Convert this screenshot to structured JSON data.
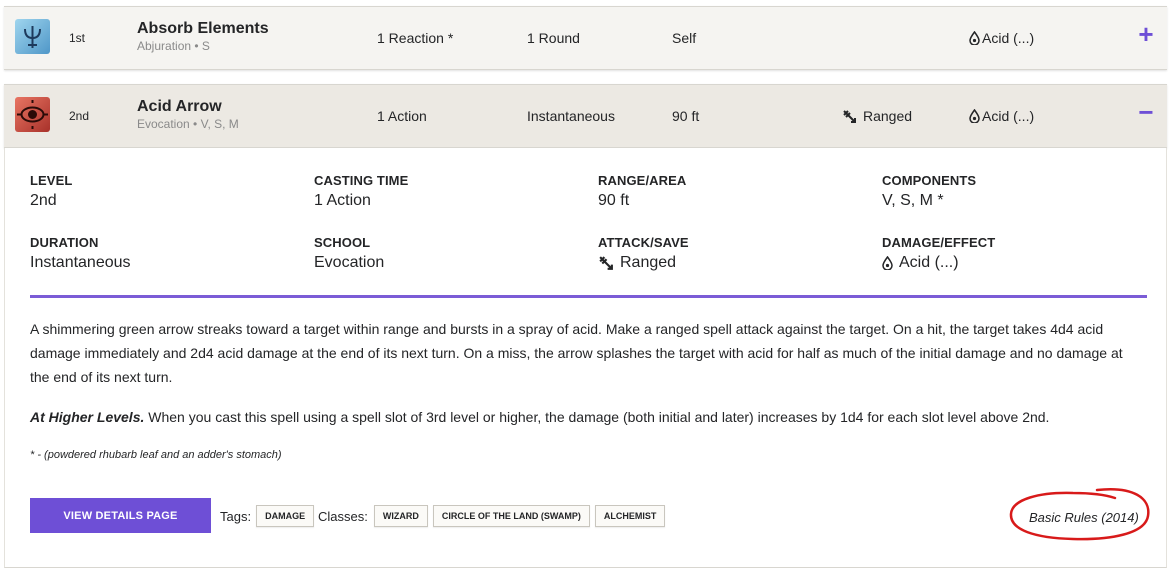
{
  "spells": [
    {
      "level": "1st",
      "name": "Absorb Elements",
      "school": "Abjuration • S",
      "casting_time": "1 Reaction *",
      "duration": "1 Round",
      "range": "Self",
      "attack": "",
      "damage": "Acid (...)",
      "toggle": "+",
      "icon": "trident-icon"
    },
    {
      "level": "2nd",
      "name": "Acid Arrow",
      "school": "Evocation • V, S, M",
      "casting_time": "1 Action",
      "duration": "Instantaneous",
      "range": "90 ft",
      "attack": "Ranged",
      "damage": "Acid (...)",
      "toggle": "−",
      "icon": "evocation-eye-icon"
    }
  ],
  "details": {
    "stats": {
      "level_label": "LEVEL",
      "level": "2nd",
      "casting_time_label": "CASTING TIME",
      "casting_time": "1 Action",
      "range_label": "RANGE/AREA",
      "range": "90 ft",
      "components_label": "COMPONENTS",
      "components": "V, S, M *",
      "duration_label": "DURATION",
      "duration": "Instantaneous",
      "school_label": "SCHOOL",
      "school": "Evocation",
      "attack_label": "ATTACK/SAVE",
      "attack": "Ranged",
      "damage_label": "DAMAGE/EFFECT",
      "damage": "Acid (...)"
    },
    "description": "A shimmering green arrow streaks toward a target within range and bursts in a spray of acid. Make a ranged spell attack against the target. On a hit, the target takes 4d4 acid damage immediately and 2d4 acid damage at the end of its next turn. On a miss, the arrow splashes the target with acid for half as much of the initial damage and no damage at the end of its next turn.",
    "higher_levels_label": "At Higher Levels.",
    "higher_levels": " When you cast this spell using a spell slot of 3rd level or higher, the damage (both initial and later) increases by 1d4 for each slot level above 2nd.",
    "material": "* - (powdered rhubarb leaf and an adder's stomach)",
    "button_label": "VIEW DETAILS PAGE",
    "tags_label": "Tags:",
    "tags": [
      "DAMAGE"
    ],
    "classes_label": "Classes:",
    "classes": [
      "WIZARD",
      "CIRCLE OF THE LAND (SWAMP)",
      "ALCHEMIST"
    ],
    "source": "Basic Rules (2014)"
  },
  "colors": {
    "accent": "#6e4fd6",
    "annotation_circle": "#d81a1a"
  }
}
